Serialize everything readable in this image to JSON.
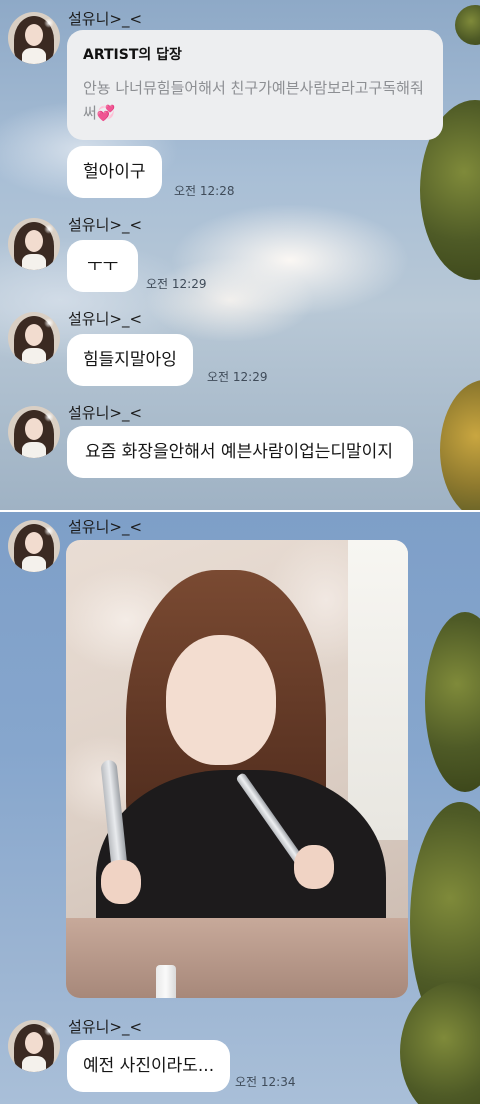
{
  "messages": [
    {
      "sender": "설유니>_<",
      "reply": {
        "header_artist": "ARTIST",
        "header_suffix": "의 답장",
        "text": "안뇽 나너뮤힘들어해서 친구가예븐사람보라고구독해줘써",
        "emoji": "💞"
      },
      "text": "헐아이구",
      "time": "오전 12:28"
    },
    {
      "sender": "설유니>_<",
      "text": "ㅜㅜ",
      "time": "오전 12:29"
    },
    {
      "sender": "설유니>_<",
      "text": "힘들지말아잉",
      "time": "오전 12:29"
    },
    {
      "sender": "설유니>_<",
      "text": "요즘 화장을안해서 예븐사람이업는디말이지"
    },
    {
      "sender": "설유니>_<",
      "image": "selfie-photo"
    },
    {
      "sender": "설유니>_<",
      "text": "예전 사진이라도...",
      "time": "오전 12:34"
    }
  ],
  "theme": {
    "bubble_color": "#ffffff",
    "reply_card_color": "#edeef0",
    "time_color": "#3f4b59"
  }
}
